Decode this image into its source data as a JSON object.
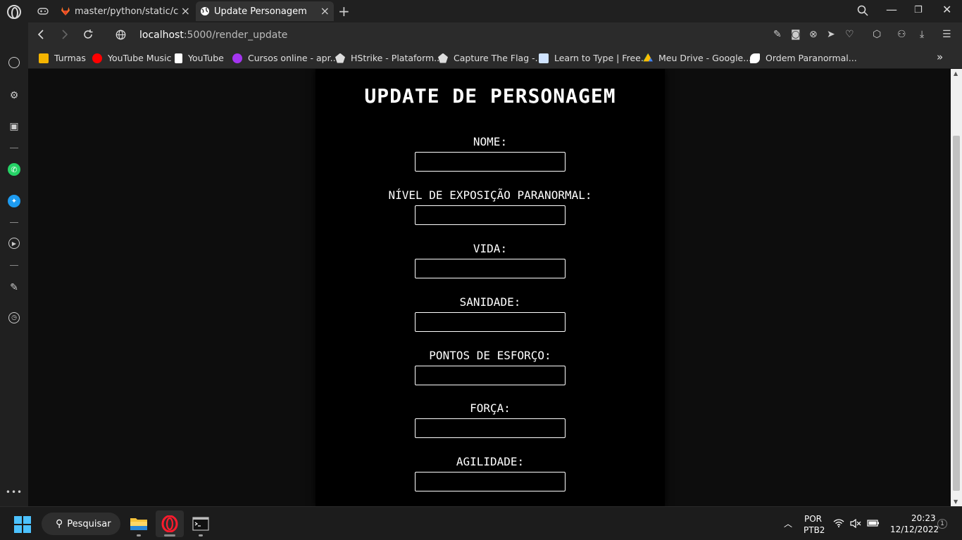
{
  "browser": {
    "tabs": [
      {
        "label": "master/python/static/css/u",
        "close": "×"
      },
      {
        "label": "Update Personagem",
        "close": "×"
      }
    ],
    "new_tab": "+",
    "window_controls": {
      "minimize": "—",
      "maximize": "❐",
      "close": "✕"
    },
    "url_host": "localhost",
    "url_path": ":5000/render_update"
  },
  "bookmarks": [
    {
      "label": "Turmas",
      "icon": "google-classroom-icon",
      "color": "#f4b400"
    },
    {
      "label": "YouTube Music",
      "icon": "youtube-music-icon",
      "color": "#ff0000"
    },
    {
      "label": "YouTube",
      "icon": "file-icon",
      "color": "#ffffff"
    },
    {
      "label": "Cursos online - apr...",
      "icon": "udemy-icon",
      "color": "#a435f0"
    },
    {
      "label": "HStrike - Plataform...",
      "icon": "hstrike-icon",
      "color": "#dddddd"
    },
    {
      "label": "Capture The Flag -...",
      "icon": "ctf-icon",
      "color": "#dddddd"
    },
    {
      "label": "Learn to Type | Free...",
      "icon": "typing-icon",
      "color": "#cfe3ff"
    },
    {
      "label": "Meu Drive - Google...",
      "icon": "google-drive-icon",
      "color": "#34a853"
    },
    {
      "label": "Ordem Paranormal...",
      "icon": "ordem-icon",
      "color": "#ffffff"
    }
  ],
  "bookmarks_more": "»",
  "page": {
    "title": "UPDATE DE PERSONAGEM",
    "fields": [
      {
        "label": "NOME:",
        "value": ""
      },
      {
        "label": "NÍVEL DE EXPOSIÇÃO PARANORMAL:",
        "value": ""
      },
      {
        "label": "VIDA:",
        "value": ""
      },
      {
        "label": "SANIDADE:",
        "value": ""
      },
      {
        "label": "PONTOS DE ESFORÇO:",
        "value": ""
      },
      {
        "label": "FORÇA:",
        "value": ""
      },
      {
        "label": "AGILIDADE:",
        "value": ""
      }
    ]
  },
  "taskbar": {
    "search_label": "Pesquisar",
    "language": "POR",
    "keyboard": "PTB2",
    "time": "20:23",
    "date": "12/12/2022",
    "notifications": "1"
  },
  "colors": {
    "page_bg": "#0d0d0d",
    "card_bg": "#000000",
    "accent_blue": "#4cc2ff",
    "opera_red": "#ff1b2d"
  }
}
